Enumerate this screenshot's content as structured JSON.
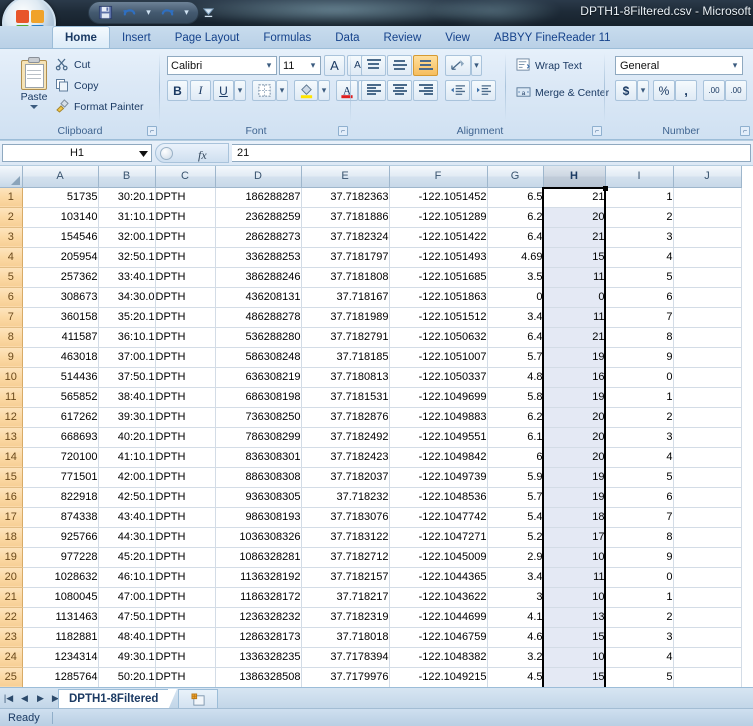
{
  "window": {
    "title": "DPTH1-8Filtered.csv - Microsoft"
  },
  "quick_access": {
    "save_tooltip": "Save",
    "undo_tooltip": "Undo",
    "redo_tooltip": "Redo",
    "customize_tooltip": "Customize Quick Access Toolbar"
  },
  "ribbon": {
    "tabs": [
      {
        "label": "Home",
        "active": true
      },
      {
        "label": "Insert",
        "active": false
      },
      {
        "label": "Page Layout",
        "active": false
      },
      {
        "label": "Formulas",
        "active": false
      },
      {
        "label": "Data",
        "active": false
      },
      {
        "label": "Review",
        "active": false
      },
      {
        "label": "View",
        "active": false
      },
      {
        "label": "ABBYY FineReader 11",
        "active": false
      }
    ],
    "groups": {
      "clipboard": {
        "label": "Clipboard",
        "paste": "Paste",
        "cut": "Cut",
        "copy": "Copy",
        "format_painter": "Format Painter"
      },
      "font": {
        "label": "Font",
        "font_name": "Calibri",
        "font_size": "11",
        "grow_font": "A",
        "shrink_font": "A",
        "bold": "B",
        "italic": "I",
        "underline": "U"
      },
      "alignment": {
        "label": "Alignment",
        "wrap_text": "Wrap Text",
        "merge_center": "Merge & Center"
      },
      "number": {
        "label": "Number",
        "format": "General",
        "currency": "$",
        "percent": "%",
        "comma": ",",
        "increase_decimal": ".00",
        "decrease_decimal": ".00"
      }
    }
  },
  "formula_bar": {
    "name_box": "H1",
    "fx_label": "fx",
    "value": "21"
  },
  "grid": {
    "columns": [
      "A",
      "B",
      "C",
      "D",
      "E",
      "F",
      "G",
      "H",
      "I",
      "J"
    ],
    "selected_column": "H",
    "active_cell": "H1",
    "rows": [
      {
        "n": "1",
        "cells": [
          "51735",
          "30:20.1",
          "DPTH",
          "186288287",
          "37.7182363",
          "-122.1051452",
          "6.5",
          "21",
          "1",
          ""
        ]
      },
      {
        "n": "2",
        "cells": [
          "103140",
          "31:10.1",
          "DPTH",
          "236288259",
          "37.7181886",
          "-122.1051289",
          "6.2",
          "20",
          "2",
          ""
        ]
      },
      {
        "n": "3",
        "cells": [
          "154546",
          "32:00.1",
          "DPTH",
          "286288273",
          "37.7182324",
          "-122.1051422",
          "6.4",
          "21",
          "3",
          ""
        ]
      },
      {
        "n": "4",
        "cells": [
          "205954",
          "32:50.1",
          "DPTH",
          "336288253",
          "37.7181797",
          "-122.1051493",
          "4.69",
          "15",
          "4",
          ""
        ]
      },
      {
        "n": "5",
        "cells": [
          "257362",
          "33:40.1",
          "DPTH",
          "386288246",
          "37.7181808",
          "-122.1051685",
          "3.5",
          "11",
          "5",
          ""
        ]
      },
      {
        "n": "6",
        "cells": [
          "308673",
          "34:30.0",
          "DPTH",
          "436208131",
          "37.718167",
          "-122.1051863",
          "0",
          "0",
          "6",
          ""
        ]
      },
      {
        "n": "7",
        "cells": [
          "360158",
          "35:20.1",
          "DPTH",
          "486288278",
          "37.7181989",
          "-122.1051512",
          "3.4",
          "11",
          "7",
          ""
        ]
      },
      {
        "n": "8",
        "cells": [
          "411587",
          "36:10.1",
          "DPTH",
          "536288280",
          "37.7182791",
          "-122.1050632",
          "6.4",
          "21",
          "8",
          ""
        ]
      },
      {
        "n": "9",
        "cells": [
          "463018",
          "37:00.1",
          "DPTH",
          "586308248",
          "37.718185",
          "-122.1051007",
          "5.7",
          "19",
          "9",
          ""
        ]
      },
      {
        "n": "10",
        "cells": [
          "514436",
          "37:50.1",
          "DPTH",
          "636308219",
          "37.7180813",
          "-122.1050337",
          "4.8",
          "16",
          "0",
          ""
        ]
      },
      {
        "n": "11",
        "cells": [
          "565852",
          "38:40.1",
          "DPTH",
          "686308198",
          "37.7181531",
          "-122.1049699",
          "5.8",
          "19",
          "1",
          ""
        ]
      },
      {
        "n": "12",
        "cells": [
          "617262",
          "39:30.1",
          "DPTH",
          "736308250",
          "37.7182876",
          "-122.1049883",
          "6.2",
          "20",
          "2",
          ""
        ]
      },
      {
        "n": "13",
        "cells": [
          "668693",
          "40:20.1",
          "DPTH",
          "786308299",
          "37.7182492",
          "-122.1049551",
          "6.1",
          "20",
          "3",
          ""
        ]
      },
      {
        "n": "14",
        "cells": [
          "720100",
          "41:10.1",
          "DPTH",
          "836308301",
          "37.7182423",
          "-122.1049842",
          "6",
          "20",
          "4",
          ""
        ]
      },
      {
        "n": "15",
        "cells": [
          "771501",
          "42:00.1",
          "DPTH",
          "886308308",
          "37.7182037",
          "-122.1049739",
          "5.9",
          "19",
          "5",
          ""
        ]
      },
      {
        "n": "16",
        "cells": [
          "822918",
          "42:50.1",
          "DPTH",
          "936308305",
          "37.718232",
          "-122.1048536",
          "5.7",
          "19",
          "6",
          ""
        ]
      },
      {
        "n": "17",
        "cells": [
          "874338",
          "43:40.1",
          "DPTH",
          "986308193",
          "37.7183076",
          "-122.1047742",
          "5.4",
          "18",
          "7",
          ""
        ]
      },
      {
        "n": "18",
        "cells": [
          "925766",
          "44:30.1",
          "DPTH",
          "1036308326",
          "37.7183122",
          "-122.1047271",
          "5.2",
          "17",
          "8",
          ""
        ]
      },
      {
        "n": "19",
        "cells": [
          "977228",
          "45:20.1",
          "DPTH",
          "1086328281",
          "37.7182712",
          "-122.1045009",
          "2.9",
          "10",
          "9",
          ""
        ]
      },
      {
        "n": "20",
        "cells": [
          "1028632",
          "46:10.1",
          "DPTH",
          "1136328192",
          "37.7182157",
          "-122.1044365",
          "3.4",
          "11",
          "0",
          ""
        ]
      },
      {
        "n": "21",
        "cells": [
          "1080045",
          "47:00.1",
          "DPTH",
          "1186328172",
          "37.718217",
          "-122.1043622",
          "3",
          "10",
          "1",
          ""
        ]
      },
      {
        "n": "22",
        "cells": [
          "1131463",
          "47:50.1",
          "DPTH",
          "1236328232",
          "37.7182319",
          "-122.1044699",
          "4.1",
          "13",
          "2",
          ""
        ]
      },
      {
        "n": "23",
        "cells": [
          "1182881",
          "48:40.1",
          "DPTH",
          "1286328173",
          "37.718018",
          "-122.1046759",
          "4.6",
          "15",
          "3",
          ""
        ]
      },
      {
        "n": "24",
        "cells": [
          "1234314",
          "49:30.1",
          "DPTH",
          "1336328235",
          "37.7178394",
          "-122.1048382",
          "3.2",
          "10",
          "4",
          ""
        ]
      },
      {
        "n": "25",
        "cells": [
          "1285764",
          "50:20.1",
          "DPTH",
          "1386328508",
          "37.7179976",
          "-122.1049215",
          "4.5",
          "15",
          "5",
          ""
        ]
      }
    ]
  },
  "sheet_tabs": {
    "sheets": [
      {
        "name": "DPTH1-8Filtered",
        "active": true
      }
    ],
    "first_tooltip": "First Sheet",
    "prev_tooltip": "Previous Sheet",
    "next_tooltip": "Next Sheet",
    "last_tooltip": "Last Sheet",
    "insert_tooltip": "Insert Worksheet"
  },
  "status_bar": {
    "mode": "Ready"
  },
  "colors": {
    "accent": "#1b3a63",
    "row_header": "#fbd9a5",
    "selection": "#e4e9f4",
    "tab_active": "#f4fafe"
  }
}
